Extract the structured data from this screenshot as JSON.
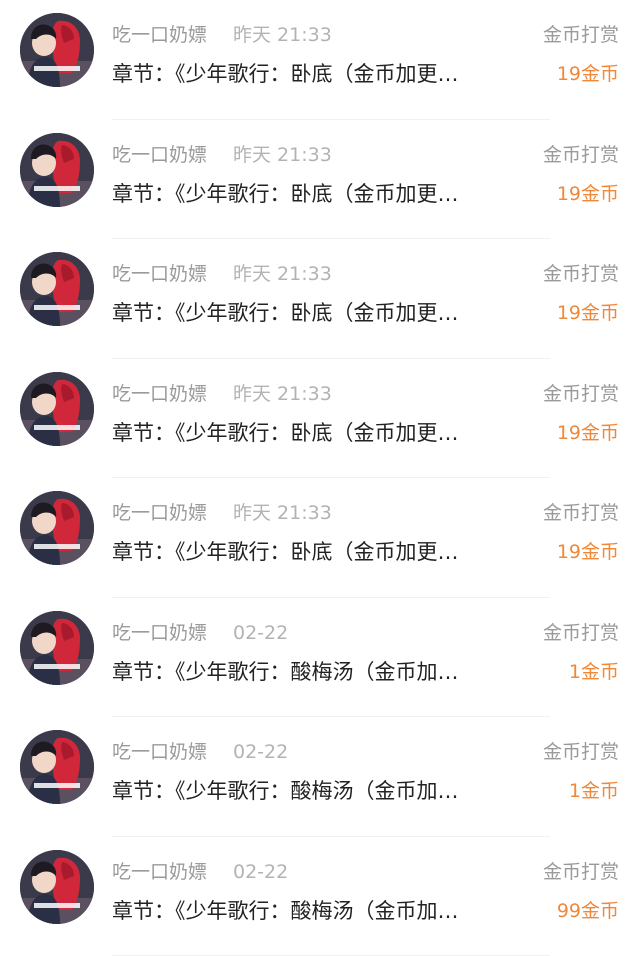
{
  "rows": [
    {
      "name": "吃一口奶嫖",
      "time": "昨天 21:33",
      "type": "金币打赏",
      "chapter": "章节：《少年歌行：卧底（金币加更…",
      "coins": "19金币",
      "avatar_text": "我要用脏也偷你"
    },
    {
      "name": "吃一口奶嫖",
      "time": "昨天 21:33",
      "type": "金币打赏",
      "chapter": "章节：《少年歌行：卧底（金币加更…",
      "coins": "19金币",
      "avatar_text": "我要用脏也偷你"
    },
    {
      "name": "吃一口奶嫖",
      "time": "昨天 21:33",
      "type": "金币打赏",
      "chapter": "章节：《少年歌行：卧底（金币加更…",
      "coins": "19金币",
      "avatar_text": "我要用脏也偷你"
    },
    {
      "name": "吃一口奶嫖",
      "time": "昨天 21:33",
      "type": "金币打赏",
      "chapter": "章节：《少年歌行：卧底（金币加更…",
      "coins": "19金币",
      "avatar_text": "我要用脏也偷你"
    },
    {
      "name": "吃一口奶嫖",
      "time": "昨天 21:33",
      "type": "金币打赏",
      "chapter": "章节：《少年歌行：卧底（金币加更…",
      "coins": "19金币",
      "avatar_text": "我要用脏也偷你"
    },
    {
      "name": "吃一口奶嫖",
      "time": "02-22",
      "type": "金币打赏",
      "chapter": "章节：《少年歌行：酸梅汤（金币加…",
      "coins": "1金币",
      "avatar_text": "我要用脏也偷你"
    },
    {
      "name": "吃一口奶嫖",
      "time": "02-22",
      "type": "金币打赏",
      "chapter": "章节：《少年歌行：酸梅汤（金币加…",
      "coins": "1金币",
      "avatar_text": "我要用脏也偷你"
    },
    {
      "name": "吃一口奶嫖",
      "time": "02-22",
      "type": "金币打赏",
      "chapter": "章节：《少年歌行：酸梅汤（金币加…",
      "coins": "99金币",
      "avatar_text": "我要用脏也偷你"
    }
  ],
  "colors": {
    "coins": "#f0883a",
    "name": "#9a9a9a",
    "time": "#b3b3b3",
    "chapter": "#222222",
    "divider": "#f0f0f0"
  }
}
